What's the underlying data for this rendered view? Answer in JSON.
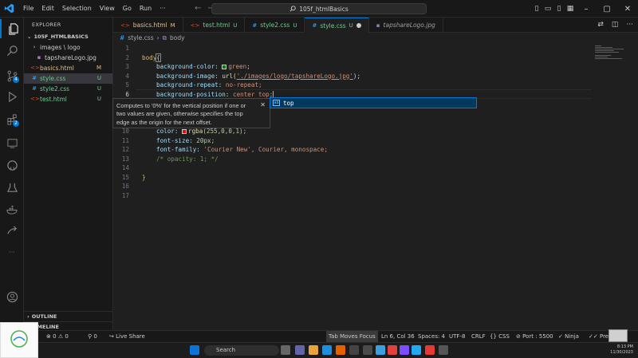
{
  "window": {
    "title": "105f_htmlBasics"
  },
  "menu": [
    "File",
    "Edit",
    "Selection",
    "View",
    "Go",
    "Run",
    "···"
  ],
  "sidebar": {
    "title": "EXPLORER",
    "root_folder": "105F_HTMLBASICS",
    "items": [
      {
        "label": "images \\ logo",
        "kind": "folder",
        "status": ""
      },
      {
        "label": "tapshareLogo.jpg",
        "kind": "image",
        "status": ""
      },
      {
        "label": "basics.html",
        "kind": "html",
        "status": "M"
      },
      {
        "label": "style.css",
        "kind": "css",
        "status": "U"
      },
      {
        "label": "style2.css",
        "kind": "css",
        "status": "U"
      },
      {
        "label": "test.html",
        "kind": "html",
        "status": "U"
      }
    ],
    "sections": {
      "outline": "OUTLINE",
      "timeline": "TIMELINE"
    }
  },
  "tabs": [
    {
      "label": "basics.html",
      "flag": "M",
      "kind": "html",
      "active": false
    },
    {
      "label": "test.html",
      "flag": "U",
      "kind": "html",
      "active": false
    },
    {
      "label": "style2.css",
      "flag": "U",
      "kind": "css",
      "active": false
    },
    {
      "label": "style.css",
      "flag": "U",
      "kind": "css",
      "active": true
    },
    {
      "label": "tapshareLogo.jpg",
      "flag": "",
      "kind": "image",
      "active": false
    }
  ],
  "breadcrumb": {
    "file": "style.css",
    "symbol": "body"
  },
  "editor": {
    "current_line": 6,
    "lines": {
      "l1": "",
      "l2_sel": "body",
      "l2_brace": "{",
      "l3_prop": "background-color:",
      "l3_val": "green",
      "l4_prop": "background-image:",
      "l4_fn": "url(",
      "l4_val": "'./images/logo/tapshareLogo.jpg'",
      "l4_end": ");",
      "l5_prop": "background-repeat:",
      "l5_val": "no-repeat;",
      "l6_prop": "background-position:",
      "l6_val": "center top;",
      "l10_prop": "color:",
      "l10_fn": "rgba",
      "l10_val": "(255,0,0,1);",
      "l11_prop": "font-size:",
      "l11_val": "20px;",
      "l12_prop": "font-family:",
      "l12_val": "'Courier New', Courier, monospace;",
      "l13_cmt": "/* opacity: 1; */",
      "l15_brace": "}"
    }
  },
  "hover_doc": {
    "text": "Computes to '0%' for the vertical position if one or two values are given, otherwise specifies the top edge as the origin for the next offset."
  },
  "suggestion": {
    "label": "top"
  },
  "statusbar": {
    "errors": "0",
    "warnings": "0",
    "ports": "0",
    "live_share": "Live Share",
    "tab_moves_focus": "Tab Moves Focus",
    "cursor": "Ln 6, Col 36",
    "spaces": "Spaces: 4",
    "encoding": "UTF-8",
    "eol": "CRLF",
    "language": "CSS",
    "port": "Port : 5500",
    "ninja": "Ninja",
    "prettier": "Prettier"
  },
  "taskbar": {
    "search_placeholder": "Search",
    "time": "8:13 PM",
    "date": "11/30/2023"
  },
  "colors": {
    "accent": "#0078d4",
    "green_swatch": "#008000",
    "red_swatch": "#ff0000"
  }
}
